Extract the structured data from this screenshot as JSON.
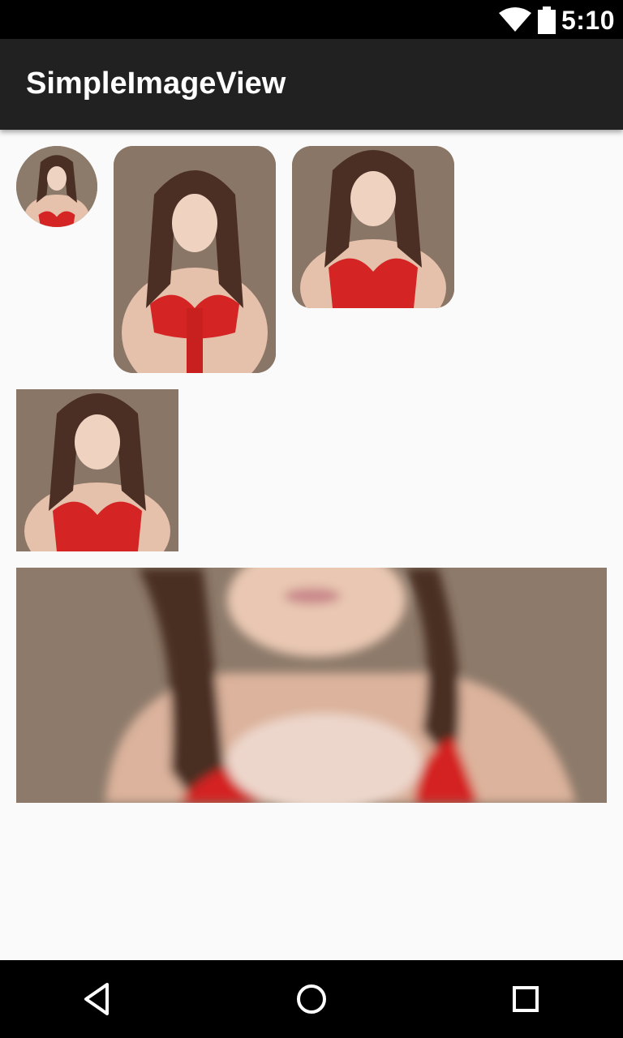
{
  "status_bar": {
    "time": "5:10",
    "icons": [
      "wifi-icon",
      "battery-icon"
    ]
  },
  "app_bar": {
    "title": "SimpleImageView"
  },
  "images": [
    {
      "name": "circle-image",
      "shape": "circle"
    },
    {
      "name": "rounded-portrait-image",
      "shape": "rounded-rect"
    },
    {
      "name": "rounded-square-image",
      "shape": "rounded-rect"
    },
    {
      "name": "square-image",
      "shape": "rect"
    },
    {
      "name": "wide-cropped-image",
      "shape": "rect"
    }
  ],
  "nav_bar": {
    "icons": [
      "back-icon",
      "home-icon",
      "recent-apps-icon"
    ]
  },
  "colors": {
    "status_bar": "#000000",
    "app_bar": "#212121",
    "background": "#fafafa",
    "nav_bar": "#000000"
  }
}
